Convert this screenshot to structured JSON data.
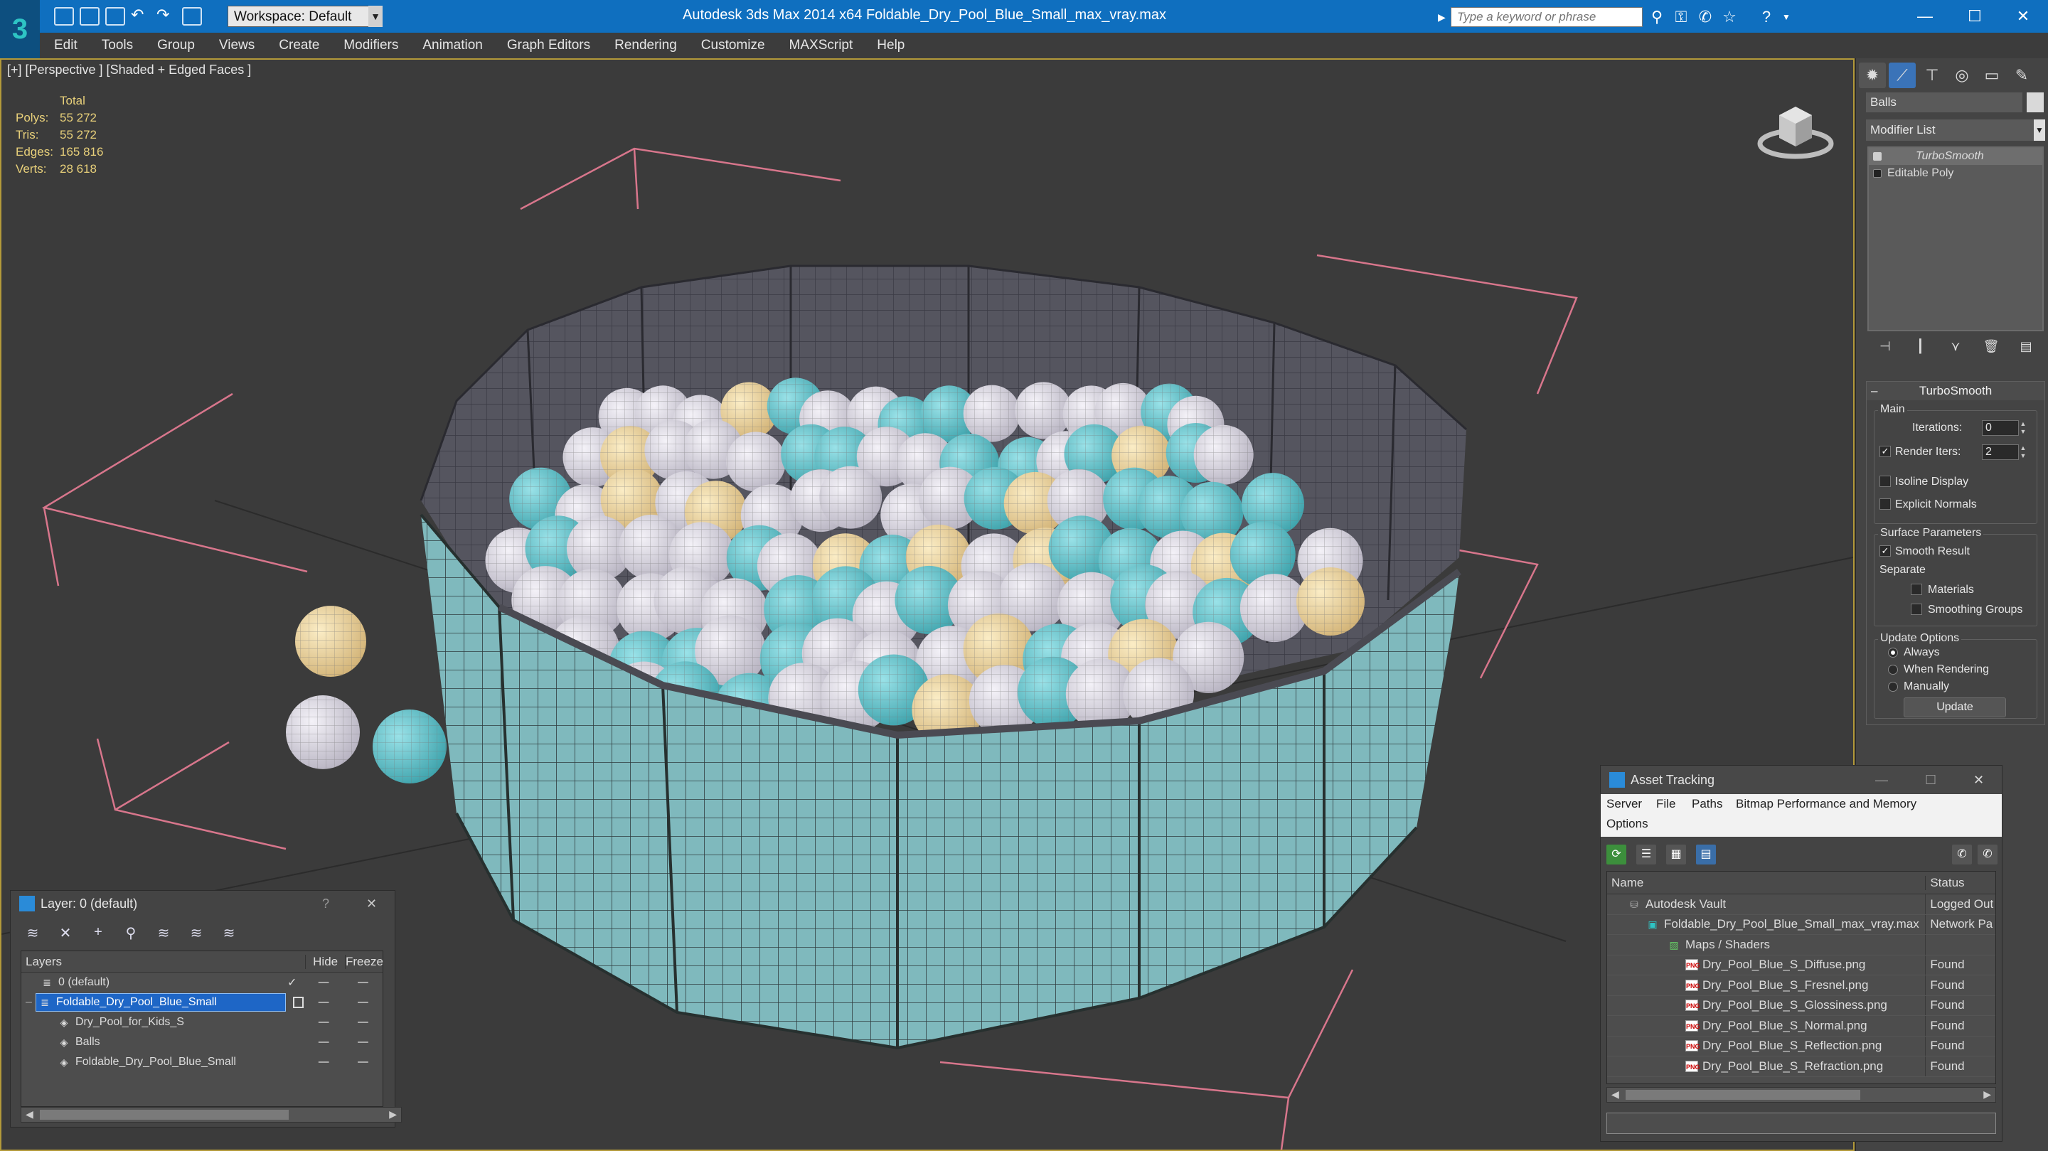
{
  "title_bar": {
    "title": "Autodesk 3ds Max  2014 x64     Foldable_Dry_Pool_Blue_Small_max_vray.max",
    "workspace": "Workspace: Default",
    "search_placeholder": "Type a keyword or phrase",
    "window_controls": [
      "minimize-icon",
      "maximize-icon",
      "close-icon"
    ]
  },
  "menu": [
    "Edit",
    "Tools",
    "Group",
    "Views",
    "Create",
    "Modifiers",
    "Animation",
    "Graph Editors",
    "Rendering",
    "Customize",
    "MAXScript",
    "Help"
  ],
  "viewport": {
    "label": "[+] [Perspective ] [Shaded + Edged Faces ]",
    "stats": {
      "header": "Total",
      "rows": [
        {
          "key": "Polys:",
          "value": "55 272"
        },
        {
          "key": "Tris:",
          "value": "55 272"
        },
        {
          "key": "Edges:",
          "value": "165 816"
        },
        {
          "key": "Verts:",
          "value": "28 618"
        }
      ]
    }
  },
  "command_panel": {
    "object_name": "Balls",
    "modifier_list": "Modifier List",
    "stack": [
      "TurboSmooth",
      "Editable Poly"
    ],
    "turbosmooth": {
      "title": "TurboSmooth",
      "main": "Main",
      "iterations_label": "Iterations:",
      "iterations_value": "0",
      "render_iters_label": "Render Iters:",
      "render_iters_value": "2",
      "isoline": "Isoline Display",
      "explicit_normals": "Explicit Normals",
      "surface_params": "Surface Parameters",
      "smooth_result": "Smooth Result",
      "separate": "Separate",
      "materials": "Materials",
      "smoothing_groups": "Smoothing Groups",
      "update_options": "Update Options",
      "always": "Always",
      "when_rendering": "When Rendering",
      "manually": "Manually",
      "update_button": "Update"
    }
  },
  "layer_dialog": {
    "title": "Layer: 0 (default)",
    "help": "?",
    "columns": [
      "Layers",
      "Hide",
      "Freeze"
    ],
    "rows": [
      {
        "name": "0 (default)",
        "indent": 0
      },
      {
        "name": "Foldable_Dry_Pool_Blue_Small",
        "indent": 0
      },
      {
        "name": "Dry_Pool_for_Kids_S",
        "indent": 1
      },
      {
        "name": "Balls",
        "indent": 1
      },
      {
        "name": "Foldable_Dry_Pool_Blue_Small",
        "indent": 1
      }
    ]
  },
  "asset_dialog": {
    "title": "Asset Tracking",
    "menu_row1": [
      "Server",
      "File",
      "Paths",
      "Bitmap Performance and Memory"
    ],
    "menu_row2": [
      "Options"
    ],
    "columns": [
      "Name",
      "Status"
    ],
    "rows": [
      {
        "name": "Autodesk Vault",
        "status": "Logged Out",
        "indent": 1
      },
      {
        "name": "Foldable_Dry_Pool_Blue_Small_max_vray.max",
        "status": "Network Pa",
        "indent": 2
      },
      {
        "name": "Maps / Shaders",
        "status": "",
        "indent": 3
      },
      {
        "name": "Dry_Pool_Blue_S_Diffuse.png",
        "status": "Found",
        "indent": 4
      },
      {
        "name": "Dry_Pool_Blue_S_Fresnel.png",
        "status": "Found",
        "indent": 4
      },
      {
        "name": "Dry_Pool_Blue_S_Glossiness.png",
        "status": "Found",
        "indent": 4
      },
      {
        "name": "Dry_Pool_Blue_S_Normal.png",
        "status": "Found",
        "indent": 4
      },
      {
        "name": "Dry_Pool_Blue_S_Reflection.png",
        "status": "Found",
        "indent": 4
      },
      {
        "name": "Dry_Pool_Blue_S_Refraction.png",
        "status": "Found",
        "indent": 4
      }
    ]
  },
  "colors": {
    "titlebar": "#0f6fbf",
    "pool_teal": "#7fb9bd",
    "ball_white": "#e6e3ec",
    "ball_teal": "#6fc9d0",
    "ball_cream": "#f0d9a0",
    "selection": "#1e66c6"
  }
}
